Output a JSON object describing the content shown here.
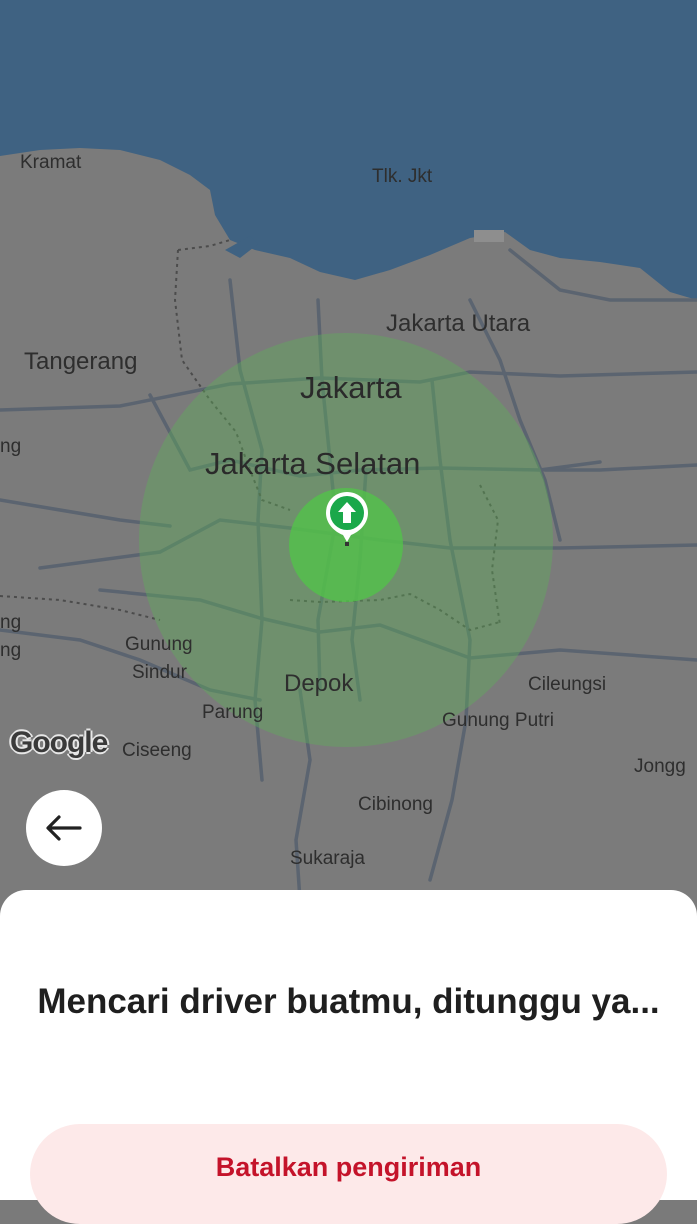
{
  "map": {
    "labels": {
      "kramat": "Kramat",
      "tlk_jkt": "Tlk. Jkt",
      "jakarta_utara": "Jakarta Utara",
      "tangerang": "Tangerang",
      "jakarta": "Jakarta",
      "jakarta_selatan": "Jakarta Selatan",
      "gunung_sindur_1": "Gunung",
      "gunung_sindur_2": "Sindur",
      "depok": "Depok",
      "cileungsi": "Cileungsi",
      "parung": "Parung",
      "gunung_putri": "Gunung Putri",
      "ciseeng": "Ciseeng",
      "jonggol": "Jongg",
      "cibinong": "Cibinong",
      "sukaraja": "Sukaraja",
      "edge_ng_1": "ng",
      "edge_ng_2": "ng",
      "edge_ng_3": "ng"
    },
    "logo": "Google",
    "colors": {
      "water": "#3f6282",
      "land": "#7b7b7b",
      "search_radius": "#5fb25a",
      "pin": "#1aa84a"
    }
  },
  "navigation": {
    "back_icon": "arrow-left-icon"
  },
  "sheet": {
    "title": "Mencari driver buatmu, ditunggu ya...",
    "cancel_button_label": "Batalkan pengiriman",
    "accent_color": "#c4132a"
  }
}
